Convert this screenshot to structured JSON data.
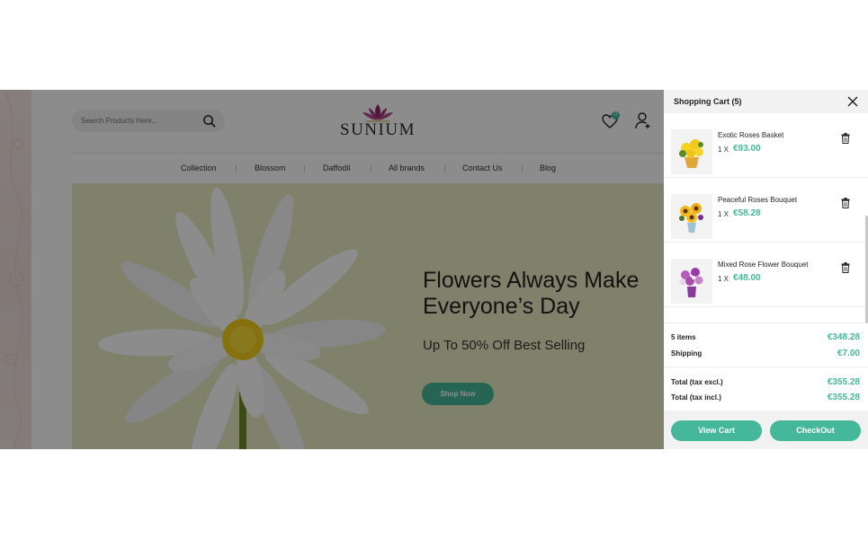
{
  "site": {
    "search": {
      "placeholder": "Search Products Here..."
    },
    "logo": {
      "text": "SUNIUM"
    },
    "wishlist": {
      "count": "0"
    },
    "nav": {
      "items": [
        "Collection",
        "Blossom",
        "Daffodil",
        "All brands",
        "Contact Us",
        "Blog"
      ]
    },
    "banner": {
      "headline_line1": "Flowers Always Make",
      "headline_line2": "Everyone’s Day",
      "subline": "Up To 50% Off Best Selling",
      "cta": "Shop Now"
    }
  },
  "cart": {
    "title": "Shopping Cart (5)",
    "items": [
      {
        "name": "Exotic Roses Basket",
        "qty": "1 X",
        "price": "€93.00"
      },
      {
        "name": "Peaceful Roses Bouquet",
        "qty": "1 X",
        "price": "€58.28"
      },
      {
        "name": "Mixed Rose Flower Bouquet",
        "qty": "1 X",
        "price": "€48.00"
      }
    ],
    "summary": {
      "items_label": "5 items",
      "items_value": "€348.28",
      "shipping_label": "Shipping",
      "shipping_value": "€7.00",
      "total_excl_label": "Total (tax excl.)",
      "total_excl_value": "€355.28",
      "total_incl_label": "Total (tax incl.)",
      "total_incl_value": "€355.28"
    },
    "view_cart": "View Cart",
    "checkout": "CheckOut"
  },
  "colors": {
    "accent": "#45b79a",
    "banner_bg": "#e7ecc1"
  }
}
